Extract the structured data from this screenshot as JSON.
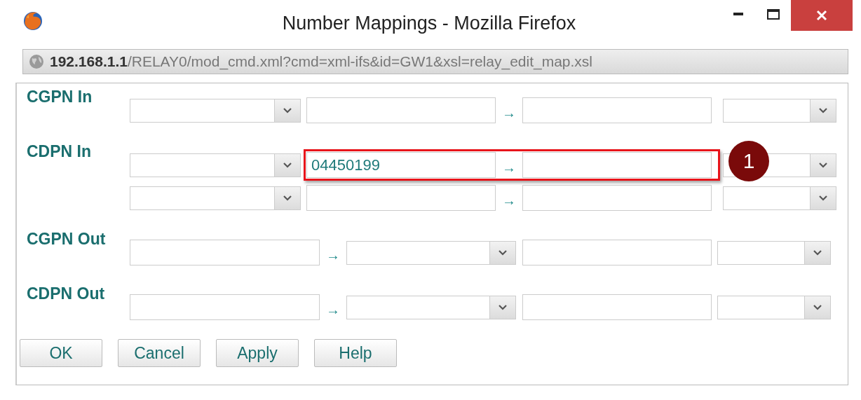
{
  "window": {
    "title": "Number Mappings - Mozilla Firefox"
  },
  "address_bar": {
    "host": "192.168.1.1",
    "path": "/RELAY0/mod_cmd.xml?cmd=xml-ifs&id=GW1&xsl=relay_edit_map.xsl"
  },
  "sections": [
    {
      "label": "CGPN In",
      "rows": [
        {
          "kind": "in",
          "arrow": "→",
          "highlighted": false
        }
      ]
    },
    {
      "label": "CDPN In",
      "rows": [
        {
          "kind": "in",
          "value": "04450199",
          "arrow": "→",
          "highlighted": true,
          "callout": "1"
        },
        {
          "kind": "in",
          "arrow": "→",
          "highlighted": false
        }
      ]
    },
    {
      "label": "CGPN Out",
      "rows": [
        {
          "kind": "out",
          "arrow": "→",
          "highlighted": false
        }
      ]
    },
    {
      "label": "CDPN Out",
      "rows": [
        {
          "kind": "out",
          "arrow": "→",
          "highlighted": false
        }
      ]
    }
  ],
  "buttons": [
    "OK",
    "Cancel",
    "Apply",
    "Help"
  ]
}
